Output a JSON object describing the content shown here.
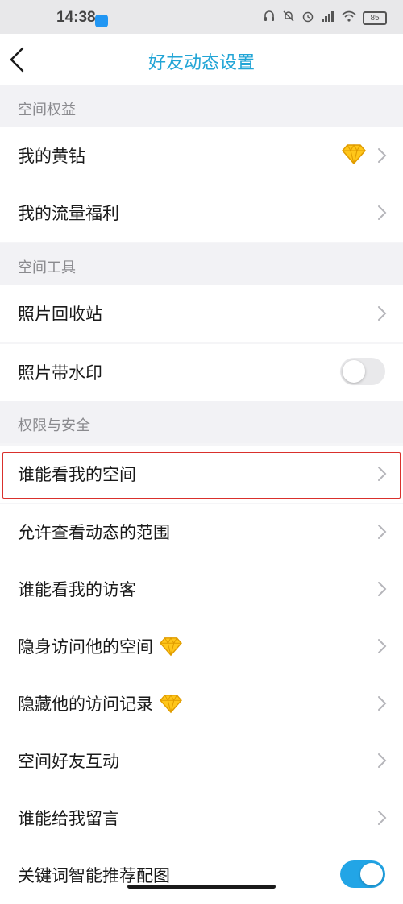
{
  "status_bar": {
    "time": "14:38",
    "battery": "85",
    "icons": [
      "headphones-icon",
      "bell-off-icon",
      "alarm-icon",
      "signal-icon",
      "wifi-icon",
      "battery-icon"
    ]
  },
  "header": {
    "title": "好友动态设置",
    "back_icon": "chevron-left-icon",
    "title_color": "#22a5d6"
  },
  "sections": [
    {
      "title": "空间权益",
      "items": [
        {
          "label": "我的黄钻",
          "accessory": "chevron",
          "badge": "diamond-icon"
        },
        {
          "label": "我的流量福利",
          "accessory": "chevron"
        }
      ]
    },
    {
      "title": "空间工具",
      "items": [
        {
          "label": "照片回收站",
          "accessory": "chevron"
        },
        {
          "label": "照片带水印",
          "accessory": "toggle",
          "toggle_on": false
        }
      ]
    },
    {
      "title": "权限与安全",
      "items": [
        {
          "label": "谁能看我的空间",
          "accessory": "chevron",
          "highlighted": true
        },
        {
          "label": "允许查看动态的范围",
          "accessory": "chevron"
        },
        {
          "label": "谁能看我的访客",
          "accessory": "chevron"
        },
        {
          "label": "隐身访问他的空间",
          "accessory": "chevron",
          "inline_badge": "diamond-icon"
        },
        {
          "label": "隐藏他的访问记录",
          "accessory": "chevron",
          "inline_badge": "diamond-icon"
        },
        {
          "label": "空间好友互动",
          "accessory": "chevron"
        },
        {
          "label": "谁能给我留言",
          "accessory": "chevron"
        },
        {
          "label": "关键词智能推荐配图",
          "accessory": "toggle",
          "toggle_on": true
        }
      ]
    }
  ],
  "colors": {
    "accent": "#22a5e6",
    "highlight_border": "#d9302c",
    "diamond": "#ffc61a"
  }
}
